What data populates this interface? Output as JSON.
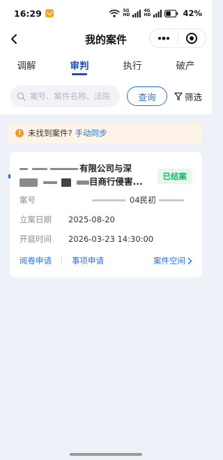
{
  "status_bar": {
    "time": "16:29",
    "net_top": "5G",
    "net_bottom": "HD",
    "net2_top": "4G",
    "net2_bottom": "HD",
    "battery": "42%"
  },
  "header": {
    "title": "我的案件"
  },
  "tabs": [
    {
      "label": "调解",
      "active": false
    },
    {
      "label": "审判",
      "active": true
    },
    {
      "label": "执行",
      "active": false
    },
    {
      "label": "破产",
      "active": false
    }
  ],
  "search": {
    "placeholder": "案号、案件名称、法院",
    "query_label": "查询",
    "filter_label": "筛选"
  },
  "banner": {
    "text": "未找到案件?",
    "link": "手动同步"
  },
  "case": {
    "title_part1": "有限公司与深",
    "title_part2": "目商行侵害...",
    "status": "已结案",
    "case_no_label": "案号",
    "case_no_value": "04民初",
    "filing_date_label": "立案日期",
    "filing_date_value": "2025-08-20",
    "hearing_time_label": "开庭时间",
    "hearing_time_value": "2026-03-23 14:30:00",
    "actions": {
      "review": "阅卷申请",
      "matter": "事项申请",
      "space": "案件空间"
    }
  },
  "colors": {
    "accent": "#2a6fe0",
    "tab_active": "#1a4fb4",
    "status_green": "#1fb36a",
    "warning": "#f39a2c"
  }
}
